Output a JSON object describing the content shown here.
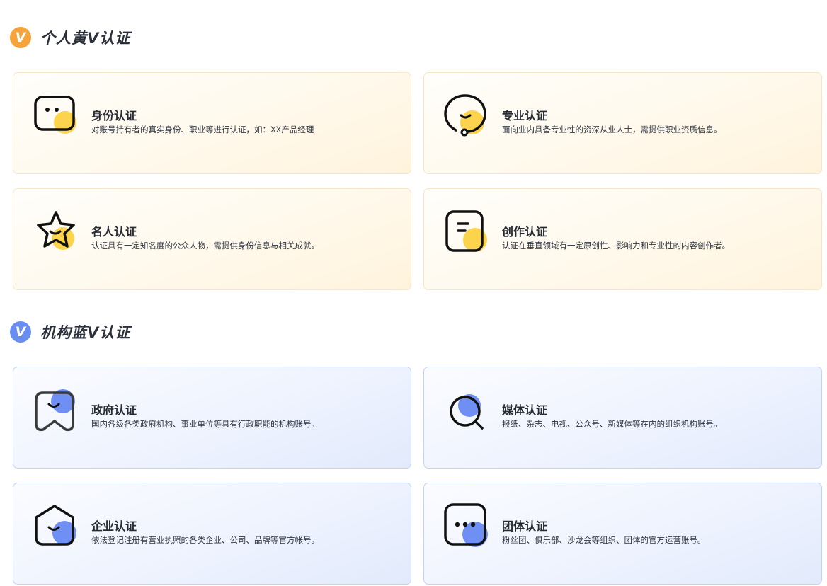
{
  "colors": {
    "personal_accent": "#f6a33b",
    "personal_blob": "#fcd34d",
    "org_accent": "#6a8df2",
    "org_blob": "#6f8ff5",
    "icon_stroke": "#111111"
  },
  "personal": {
    "badge_icon": "v-badge-icon",
    "badge_letter": "V",
    "title": "个人黄V认证",
    "cards": [
      {
        "icon": "face-square-icon",
        "title": "身份认证",
        "desc": "对账号持有者的真实身份、职业等进行认证，如：XX产品经理"
      },
      {
        "icon": "headset-chat-icon",
        "title": "专业认证",
        "desc": "面向业内具备专业性的资深从业人士，需提供职业资质信息。"
      },
      {
        "icon": "star-smile-icon",
        "title": "名人认证",
        "desc": "认证具有一定知名度的公众人物，需提供身份信息与相关成就。"
      },
      {
        "icon": "document-note-icon",
        "title": "创作认证",
        "desc": "认证在垂直领域有一定原创性、影响力和专业性的内容创作者。"
      }
    ]
  },
  "organization": {
    "badge_icon": "v-badge-icon",
    "badge_letter": "V",
    "title": "机构蓝V认证",
    "cards": [
      {
        "icon": "government-flag-icon",
        "title": "政府认证",
        "desc": "国内各级各类政府机构、事业单位等具有行政职能的机构账号。"
      },
      {
        "icon": "magnifier-icon",
        "title": "媒体认证",
        "desc": "报纸、杂志、电视、公众号、新媒体等在内的组织机构账号。"
      },
      {
        "icon": "house-smile-icon",
        "title": "企业认证",
        "desc": "依法登记注册有营业执照的各类企业、公司、品牌等官方帐号。"
      },
      {
        "icon": "chat-dots-icon",
        "title": "团体认证",
        "desc": "粉丝团、俱乐部、沙龙会等组织、团体的官方运营账号。"
      }
    ]
  }
}
